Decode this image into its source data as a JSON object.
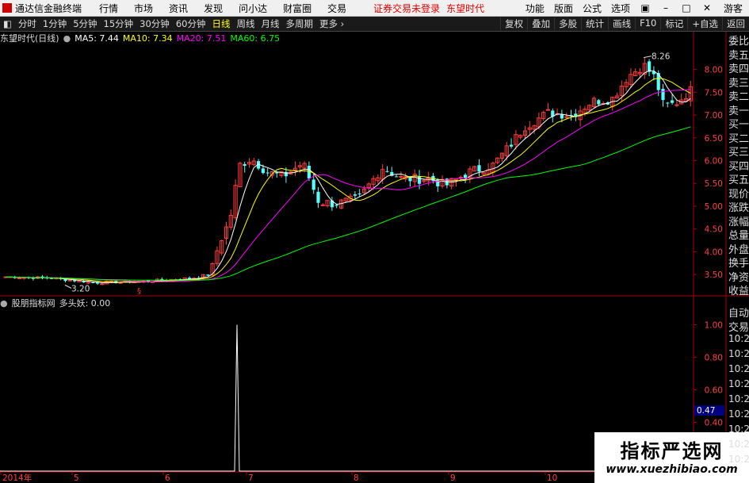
{
  "titlebar": {
    "app_title": "通达信金融终端",
    "menu": [
      "行情",
      "市场",
      "资讯",
      "发现",
      "问小达",
      "财富圈",
      "交易"
    ],
    "warning": "证券交易未登录",
    "brand": "东望时代",
    "right": [
      "功能",
      "版面",
      "公式",
      "选项"
    ],
    "user": "游客"
  },
  "toolbar": {
    "periods": [
      "分时",
      "1分钟",
      "5分钟",
      "15分钟",
      "30分钟",
      "60分钟",
      "日线",
      "周线",
      "月线",
      "多周期",
      "更多 ›"
    ],
    "active_period": "日线",
    "right": [
      "复权",
      "叠加",
      "多股",
      "统计",
      "画线",
      "F10",
      "标记",
      "+自选",
      "返回"
    ]
  },
  "main_chart": {
    "stock_label": "东望时代(日线)",
    "ma": [
      {
        "label": "MA5: 7.44",
        "color": "#ffffff"
      },
      {
        "label": "MA10: 7.34",
        "color": "#ffff00"
      },
      {
        "label": "MA20: 7.51",
        "color": "#ff00ff"
      },
      {
        "label": "MA60: 6.75",
        "color": "#00ff00"
      }
    ],
    "high_label": "8.26",
    "low_label": "3.20",
    "y_ticks": [
      "8.00",
      "7.50",
      "7.00",
      "6.50",
      "6.00",
      "5.50",
      "5.00",
      "4.50",
      "4.00",
      "3.50"
    ]
  },
  "indicator": {
    "label": "股朋指标网",
    "name_value": "多头妖: 0.00",
    "y_ticks": [
      "1.00",
      "0.80",
      "0.60",
      "0.40",
      "0.20"
    ],
    "current_value": "0.47"
  },
  "x_axis": [
    "2014年",
    "5",
    "6",
    "7",
    "8",
    "9",
    "10"
  ],
  "side_panel": {
    "labels": [
      "委比",
      "卖五",
      "卖四",
      "卖三",
      "卖二",
      "卖一",
      "买一",
      "买二",
      "买三",
      "买四",
      "买五",
      "现价",
      "涨跌",
      "涨幅",
      "总量",
      "外盘",
      "换手",
      "净资",
      "收益"
    ],
    "trade_labels": [
      "自动",
      "交易"
    ],
    "times": [
      "10:24",
      "10:24",
      "10:24",
      "10:24",
      "10:24",
      "10:24",
      "10:24",
      "10:25",
      "10:25"
    ]
  },
  "watermark": {
    "title": "指标严选网",
    "url": "www.xuezhibiao.com"
  }
}
